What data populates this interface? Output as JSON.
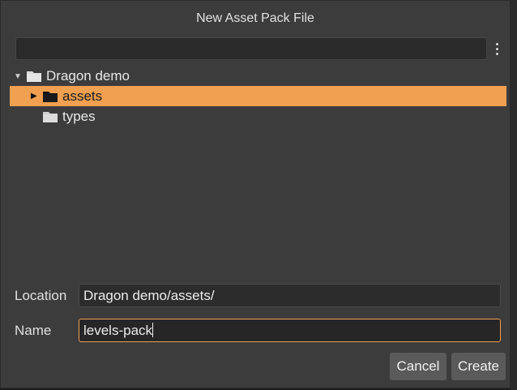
{
  "dialog": {
    "title": "New Asset Pack File"
  },
  "filter": {
    "value": "",
    "placeholder": ""
  },
  "tree": {
    "root": {
      "label": "Dragon demo",
      "expanded": true
    },
    "items": [
      {
        "label": "assets",
        "selected": true,
        "has_children": true
      },
      {
        "label": "types",
        "selected": false,
        "has_children": false
      }
    ]
  },
  "form": {
    "location_label": "Location",
    "location_value": "Dragon demo/assets/",
    "name_label": "Name",
    "name_value": "levels-pack"
  },
  "buttons": {
    "cancel_label": "Cancel",
    "create_label": "Create"
  },
  "colors": {
    "selection": "#f0a050",
    "dialog_bg": "#3c3c3c",
    "focus_border": "#f0a050"
  },
  "icons": {
    "folder": "folder-icon",
    "menu": "kebab-menu-icon",
    "expand": "triangle-right-icon",
    "collapse": "triangle-down-icon"
  }
}
